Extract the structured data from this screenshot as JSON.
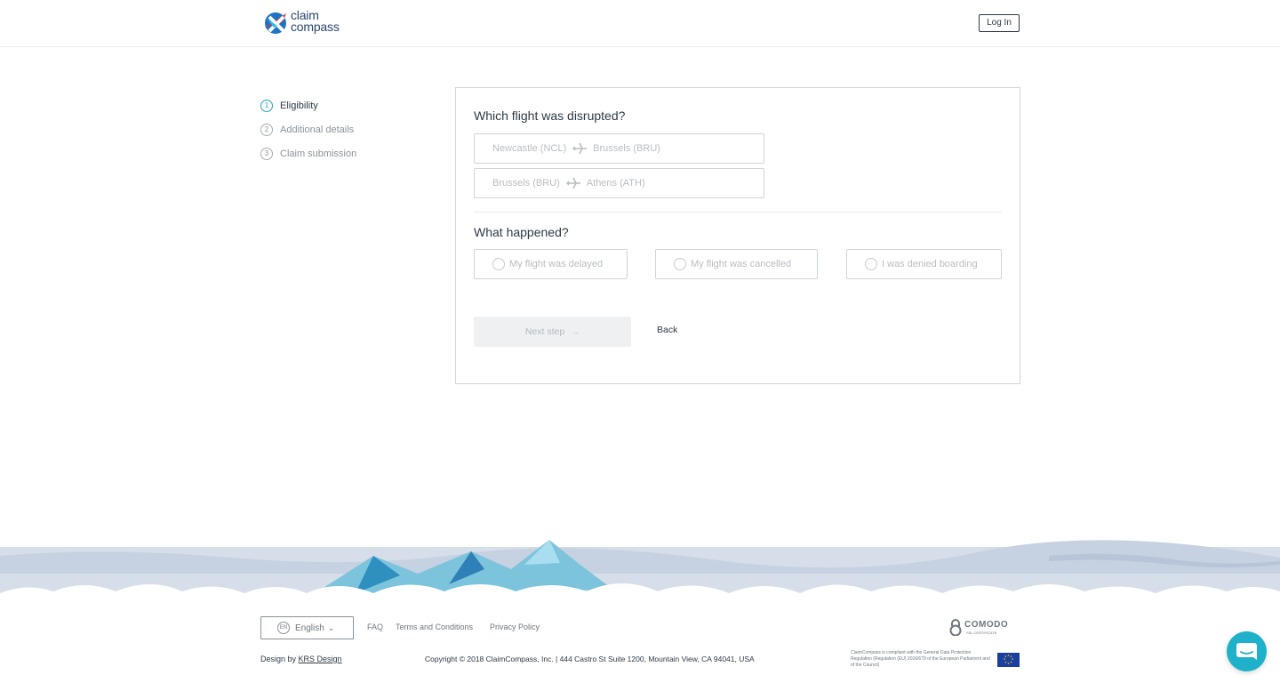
{
  "header": {
    "logo_line1": "claim",
    "logo_line2": "compass",
    "login_label": "Log In"
  },
  "steps": [
    {
      "num": "1",
      "label": "Eligibility",
      "active": true
    },
    {
      "num": "2",
      "label": "Additional details",
      "active": false
    },
    {
      "num": "3",
      "label": "Claim submission",
      "active": false
    }
  ],
  "form": {
    "flight_question": "Which flight was disrupted?",
    "flights": [
      {
        "from": "Newcastle (NCL)",
        "to": "Brussels (BRU)"
      },
      {
        "from": "Brussels (BRU)",
        "to": "Athens (ATH)"
      }
    ],
    "happened_question": "What happened?",
    "options": [
      {
        "label": "My flight was delayed"
      },
      {
        "label": "My flight was cancelled"
      },
      {
        "label": "I was denied boarding"
      }
    ],
    "next_label": "Next step",
    "back_label": "Back"
  },
  "footer": {
    "lang_code": "EN",
    "lang_label": "English",
    "links": [
      "FAQ",
      "Terms and Conditions",
      "Privacy Policy"
    ],
    "design_prefix": "Design by ",
    "design_link": "KRS Design",
    "copyright": "Copyright © 2018 ClaimCompass, Inc. | 444 Castro St Suite 1200, Mountain View, CA 94041, USA",
    "comodo": "COMODO",
    "comodo_sub": "SSL CERTIFICATE",
    "gdpr": "ClaimCompass is compliant with the General Data Protection Regulation (Regulation (EU) 2016/679 of the European Parliament and of the Council)"
  },
  "colors": {
    "accent": "#21a6c3",
    "text": "#2c3a47",
    "border": "#cfd5da",
    "chat": "#1fb1c9"
  }
}
